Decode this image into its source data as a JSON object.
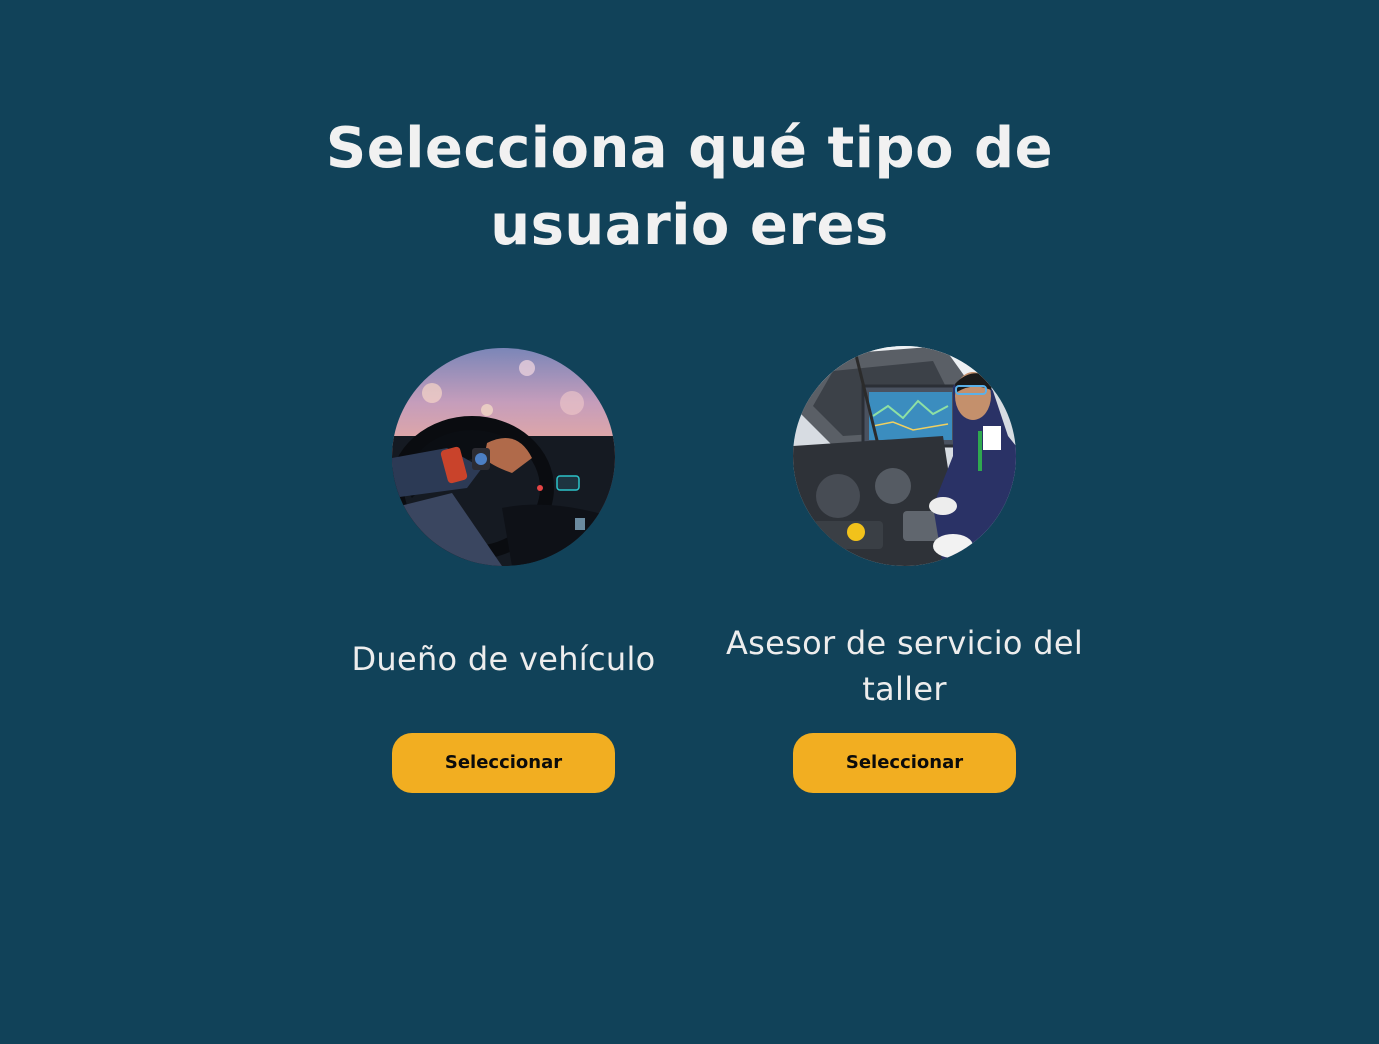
{
  "page": {
    "title": "Selecciona qué tipo de usuario eres",
    "background_color": "#114259",
    "accent_color": "#F2AE21"
  },
  "options": [
    {
      "label": "Dueño de vehículo",
      "button_label": "Seleccionar",
      "image_description_icon": "car-driver-photo"
    },
    {
      "label": "Asesor de servicio del taller",
      "button_label": "Seleccionar",
      "image_description_icon": "mechanic-workshop-photo"
    }
  ]
}
